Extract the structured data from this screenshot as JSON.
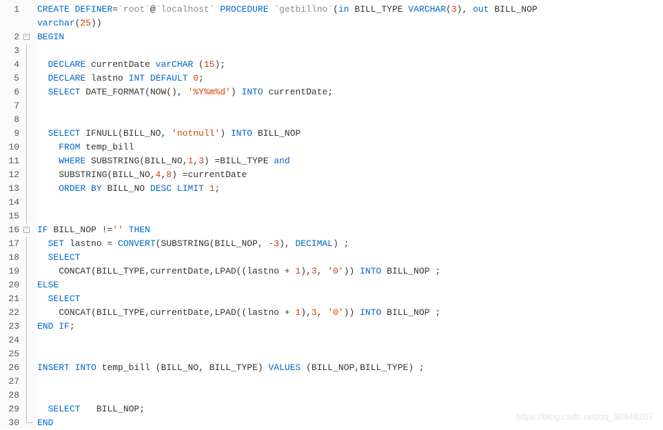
{
  "watermark": "https://blog.csdn.net/qq_30948207",
  "fold": {
    "2": "open",
    "16": "open"
  },
  "lines": [
    {
      "n": 1,
      "tokens": [
        [
          "kw",
          "CREATE"
        ],
        [
          " "
        ],
        [
          "kw",
          "DEFINER"
        ],
        [
          "op",
          "="
        ],
        [
          "backtick",
          "`root`"
        ],
        [
          "op",
          "@"
        ],
        [
          "backtick",
          "`localhost`"
        ],
        [
          " "
        ],
        [
          "kw",
          "PROCEDURE"
        ],
        [
          " "
        ],
        [
          "backtick",
          "`getbillno`"
        ],
        [
          "op",
          "("
        ],
        [
          "kw",
          "in"
        ],
        [
          " BILL_TYPE "
        ],
        [
          "kw",
          "VARCHAR"
        ],
        [
          "op",
          "("
        ],
        [
          "num",
          "3"
        ],
        [
          "op",
          "),"
        ],
        [
          " "
        ],
        [
          "kw",
          "out"
        ],
        [
          " BILL_NOP "
        ]
      ],
      "cont": [
        [
          "kw",
          "varchar"
        ],
        [
          "op",
          "("
        ],
        [
          "num",
          "25"
        ],
        [
          "op",
          "))"
        ]
      ]
    },
    {
      "n": 2,
      "tokens": [
        [
          "kw",
          "BEGIN"
        ]
      ]
    },
    {
      "n": 3,
      "tokens": [
        [
          ""
        ]
      ]
    },
    {
      "n": 4,
      "tokens": [
        [
          "  "
        ],
        [
          "kw",
          "DECLARE"
        ],
        [
          " currentDate "
        ],
        [
          "kw",
          "varCHAR"
        ],
        [
          " ("
        ],
        [
          "num",
          "15"
        ],
        [
          ");"
        ]
      ]
    },
    {
      "n": 5,
      "tokens": [
        [
          "  "
        ],
        [
          "kw",
          "DECLARE"
        ],
        [
          " lastno "
        ],
        [
          "kw",
          "INT"
        ],
        [
          " "
        ],
        [
          "kw",
          "DEFAULT"
        ],
        [
          " "
        ],
        [
          "num",
          "0"
        ],
        [
          ";"
        ]
      ]
    },
    {
      "n": 6,
      "tokens": [
        [
          "  "
        ],
        [
          "kw",
          "SELECT"
        ],
        [
          " DATE_FORMAT(NOW(), "
        ],
        [
          "str",
          "'%Y%m%d'"
        ],
        [
          ") "
        ],
        [
          "kw",
          "INTO"
        ],
        [
          " currentDate;"
        ]
      ]
    },
    {
      "n": 7,
      "tokens": [
        [
          ""
        ]
      ]
    },
    {
      "n": 8,
      "tokens": [
        [
          ""
        ]
      ]
    },
    {
      "n": 9,
      "tokens": [
        [
          "  "
        ],
        [
          "kw",
          "SELECT"
        ],
        [
          " IFNULL(BILL_NO, "
        ],
        [
          "str",
          "'notnull'"
        ],
        [
          ") "
        ],
        [
          "kw",
          "INTO"
        ],
        [
          " BILL_NOP"
        ]
      ]
    },
    {
      "n": 10,
      "tokens": [
        [
          "    "
        ],
        [
          "kw",
          "FROM"
        ],
        [
          " temp_bill"
        ]
      ]
    },
    {
      "n": 11,
      "tokens": [
        [
          "    "
        ],
        [
          "kw",
          "WHERE"
        ],
        [
          " SUBSTRING(BILL_NO,"
        ],
        [
          "num",
          "1"
        ],
        [
          ","
        ],
        [
          "num",
          "3"
        ],
        [
          ") =BILL_TYPE "
        ],
        [
          "kw",
          "and"
        ]
      ]
    },
    {
      "n": 12,
      "tokens": [
        [
          "    SUBSTRING(BILL_NO,"
        ],
        [
          "num",
          "4"
        ],
        [
          ","
        ],
        [
          "num",
          "8"
        ],
        [
          ") =currentDate"
        ]
      ]
    },
    {
      "n": 13,
      "tokens": [
        [
          "    "
        ],
        [
          "kw",
          "ORDER"
        ],
        [
          " "
        ],
        [
          "kw",
          "BY"
        ],
        [
          " BILL_NO "
        ],
        [
          "kw",
          "DESC"
        ],
        [
          " "
        ],
        [
          "kw",
          "LIMIT"
        ],
        [
          " "
        ],
        [
          "num",
          "1"
        ],
        [
          ";"
        ]
      ]
    },
    {
      "n": 14,
      "tokens": [
        [
          ""
        ]
      ]
    },
    {
      "n": 15,
      "tokens": [
        [
          ""
        ]
      ]
    },
    {
      "n": 16,
      "tokens": [
        [
          "kw",
          "IF"
        ],
        [
          " BILL_NOP !="
        ],
        [
          "str",
          "''"
        ],
        [
          " "
        ],
        [
          "kw",
          "THEN"
        ]
      ]
    },
    {
      "n": 17,
      "tokens": [
        [
          "  "
        ],
        [
          "kw",
          "SET"
        ],
        [
          " lastno = "
        ],
        [
          "kw",
          "CONVERT"
        ],
        [
          "(SUBSTRING(BILL_NOP, "
        ],
        [
          "num",
          "-3"
        ],
        [
          "), "
        ],
        [
          "kw",
          "DECIMAL"
        ],
        [
          ") ;"
        ]
      ]
    },
    {
      "n": 18,
      "tokens": [
        [
          "  "
        ],
        [
          "kw",
          "SELECT"
        ]
      ]
    },
    {
      "n": 19,
      "tokens": [
        [
          "    CONCAT(BILL_TYPE,currentDate,LPAD((lastno + "
        ],
        [
          "num",
          "1"
        ],
        [
          "),"
        ],
        [
          "num",
          "3"
        ],
        [
          ", "
        ],
        [
          "str",
          "'0'"
        ],
        [
          ")) "
        ],
        [
          "kw",
          "INTO"
        ],
        [
          " BILL_NOP ;"
        ]
      ]
    },
    {
      "n": 20,
      "tokens": [
        [
          "kw",
          "ELSE"
        ]
      ]
    },
    {
      "n": 21,
      "tokens": [
        [
          "  "
        ],
        [
          "kw",
          "SELECT"
        ]
      ]
    },
    {
      "n": 22,
      "tokens": [
        [
          "    CONCAT(BILL_TYPE,currentDate,LPAD((lastno + "
        ],
        [
          "num",
          "1"
        ],
        [
          "),"
        ],
        [
          "num",
          "3"
        ],
        [
          ", "
        ],
        [
          "str",
          "'0'"
        ],
        [
          ")) "
        ],
        [
          "kw",
          "INTO"
        ],
        [
          " BILL_NOP ;"
        ]
      ]
    },
    {
      "n": 23,
      "tokens": [
        [
          "kw",
          "END"
        ],
        [
          " "
        ],
        [
          "kw",
          "IF"
        ],
        [
          ";"
        ]
      ]
    },
    {
      "n": 24,
      "tokens": [
        [
          ""
        ]
      ]
    },
    {
      "n": 25,
      "tokens": [
        [
          ""
        ]
      ]
    },
    {
      "n": 26,
      "tokens": [
        [
          "kw",
          "INSERT"
        ],
        [
          " "
        ],
        [
          "kw",
          "INTO"
        ],
        [
          " temp_bill (BILL_NO, BILL_TYPE) "
        ],
        [
          "kw",
          "VALUES"
        ],
        [
          " (BILL_NOP,BILL_TYPE) ;"
        ]
      ]
    },
    {
      "n": 27,
      "tokens": [
        [
          ""
        ]
      ]
    },
    {
      "n": 28,
      "tokens": [
        [
          ""
        ]
      ]
    },
    {
      "n": 29,
      "tokens": [
        [
          "  "
        ],
        [
          "kw",
          "SELECT"
        ],
        [
          "   BILL_NOP;"
        ]
      ]
    },
    {
      "n": 30,
      "tokens": [
        [
          "kw",
          "END"
        ]
      ]
    }
  ]
}
